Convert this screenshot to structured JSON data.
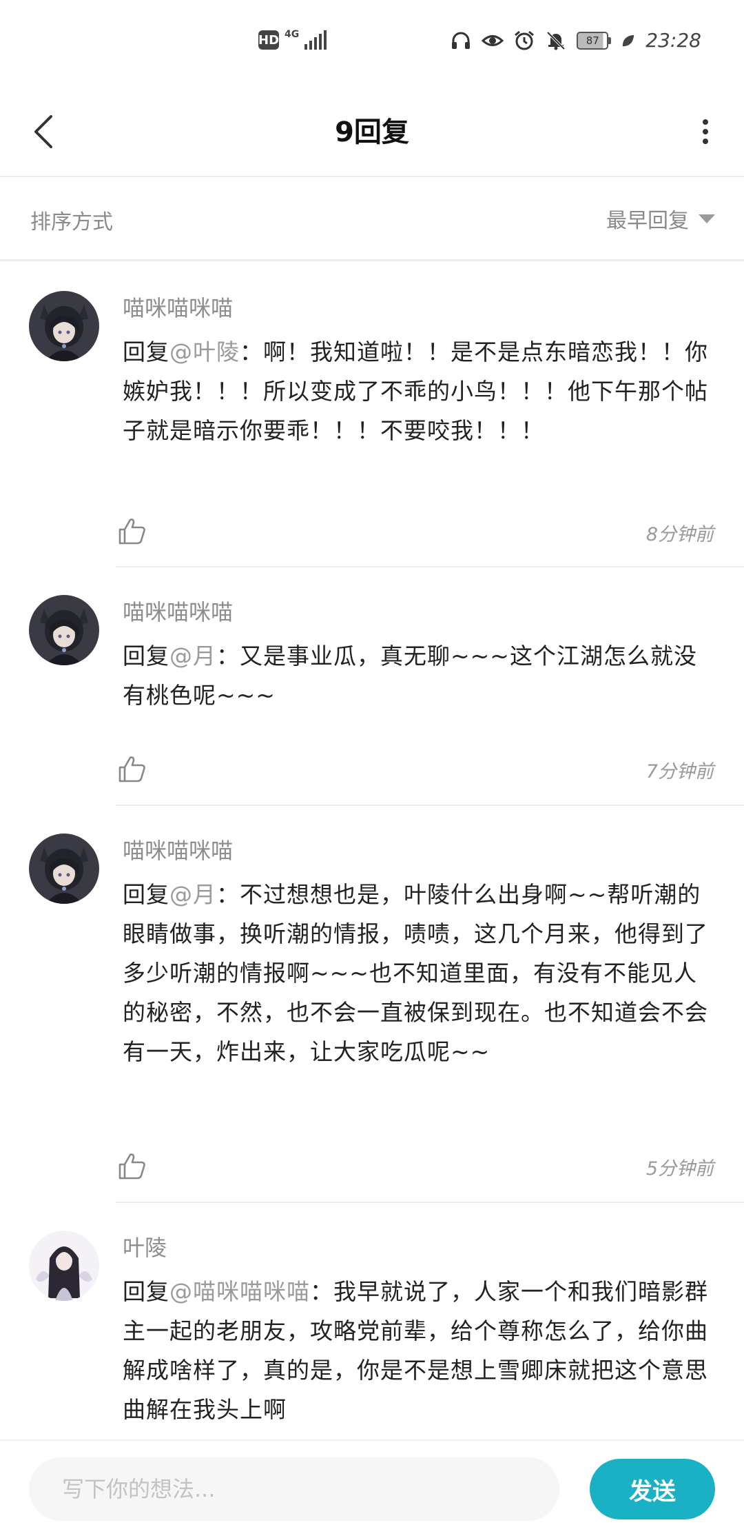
{
  "status_bar": {
    "hd": "HD",
    "network": "4G",
    "battery": "87",
    "time": "23:28"
  },
  "header": {
    "title": "9回复"
  },
  "sort": {
    "label": "排序方式",
    "selected": "最早回复"
  },
  "comments": [
    {
      "name": "喵咪喵咪喵",
      "reply_prefix": "回复",
      "mention": "@叶陵",
      "text": "：啊！我知道啦！！是不是点东暗恋我！！你嫉妒我！！！所以变成了不乖的小鸟！！！他下午那个帖子就是暗示你要乖！！！不要咬我！！！",
      "time": "8分钟前"
    },
    {
      "name": "喵咪喵咪喵",
      "reply_prefix": "回复",
      "mention": "@月",
      "text": "：又是事业瓜，真无聊~~~这个江湖怎么就没有桃色呢~~~",
      "time": "7分钟前"
    },
    {
      "name": "喵咪喵咪喵",
      "reply_prefix": "回复",
      "mention": "@月",
      "text": "：不过想想也是，叶陵什么出身啊~~帮听潮的眼睛做事，换听潮的情报，啧啧，这几个月来，他得到了多少听潮的情报啊~~~也不知道里面，有没有不能见人的秘密，不然，也不会一直被保到现在。也不知道会不会有一天，炸出来，让大家吃瓜呢~~",
      "time": "5分钟前"
    },
    {
      "name": "叶陵",
      "reply_prefix": "回复",
      "mention": "@喵咪喵咪喵",
      "text": "：我早就说了，人家一个和我们暗影群主一起的老朋友，攻略党前辈，给个尊称怎么了，给你曲解成啥样了，真的是，你是不是想上雪卿床就把这个意思曲解在我头上啊",
      "time": ""
    }
  ],
  "composer": {
    "placeholder": "写下你的想法...",
    "send_label": "发送"
  },
  "colors": {
    "accent": "#1bb1c4",
    "muted_text": "#8e8e8e",
    "divider": "#ececec"
  },
  "icons": {
    "back": "chevron-left-icon",
    "more": "more-vertical-icon",
    "like": "thumbs-up-icon",
    "sort": "triangle-down-icon"
  }
}
